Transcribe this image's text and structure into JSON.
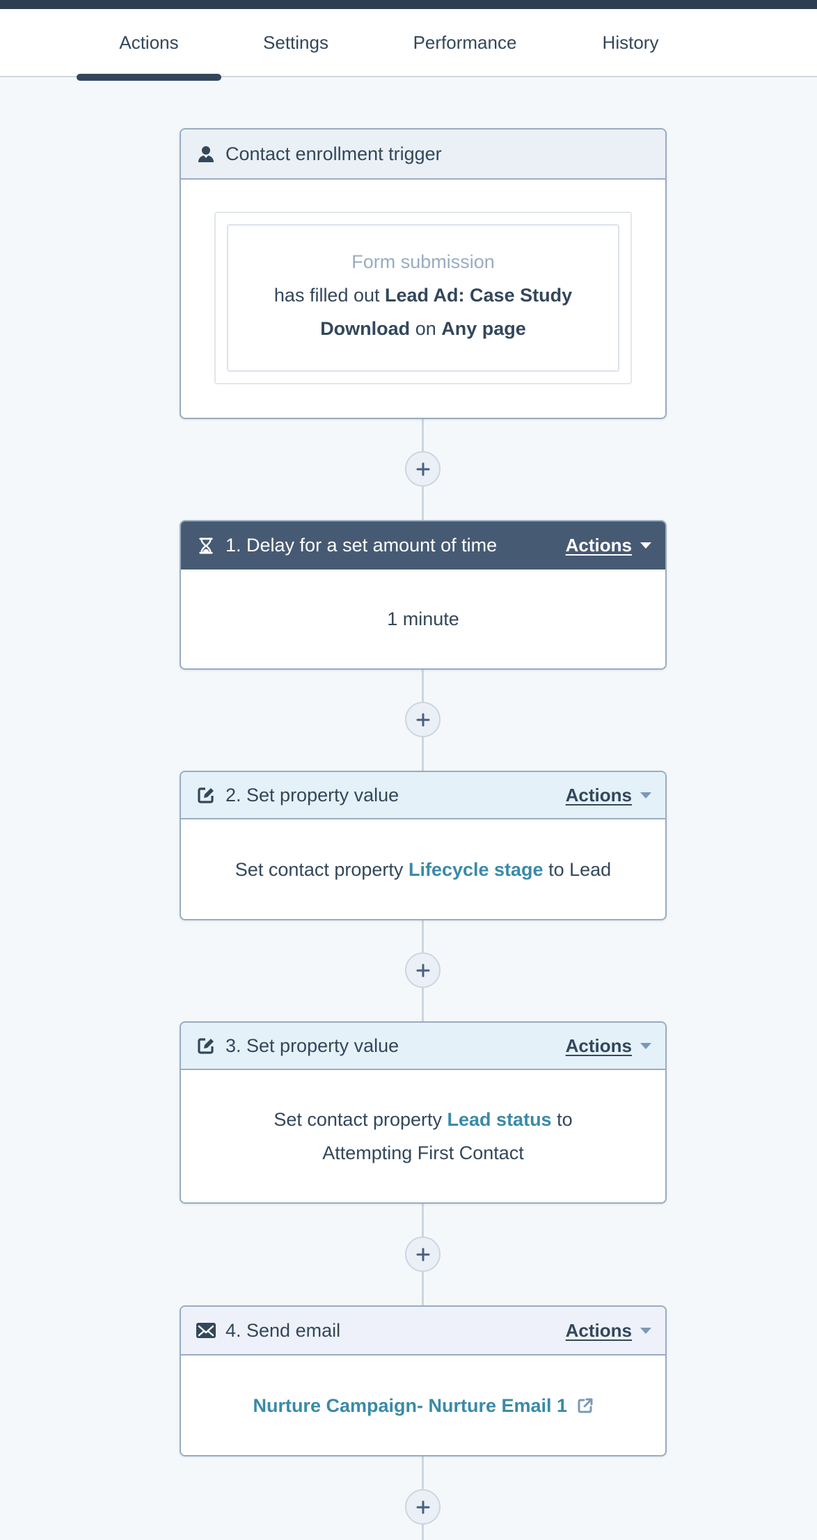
{
  "tabs": [
    {
      "label": "Actions",
      "active": true
    },
    {
      "label": "Settings",
      "active": false
    },
    {
      "label": "Performance",
      "active": false
    },
    {
      "label": "History",
      "active": false
    }
  ],
  "colors": {
    "topbar": "#2d3e50",
    "text": "#33475b",
    "link": "#3a8aa8",
    "dark_header": "#475a74",
    "border": "#99acc2"
  },
  "trigger": {
    "icon": "contact-icon",
    "title": "Contact enrollment trigger",
    "filter_type": "Form submission",
    "desc_prefix": "has filled out",
    "form_name": "Lead Ad: Case Study Download",
    "desc_mid": "on",
    "page": "Any page"
  },
  "steps": [
    {
      "icon": "hourglass-icon",
      "title": "1. Delay for a set amount of time",
      "actions_label": "Actions",
      "body": "1 minute"
    },
    {
      "icon": "edit-icon",
      "title": "2. Set property value",
      "actions_label": "Actions",
      "body_prefix": "Set contact property",
      "property": "Lifecycle stage",
      "body_mid": "to",
      "value": "Lead"
    },
    {
      "icon": "edit-icon",
      "title": "3. Set property value",
      "actions_label": "Actions",
      "body_prefix": "Set contact property",
      "property": "Lead status",
      "body_mid": "to",
      "value": "Attempting First Contact"
    },
    {
      "icon": "email-icon",
      "title": "4. Send email",
      "actions_label": "Actions",
      "email_name": "Nurture Campaign- Nurture Email 1",
      "link_icon": "external-link-icon"
    }
  ],
  "add_action_icon": "plus-icon"
}
